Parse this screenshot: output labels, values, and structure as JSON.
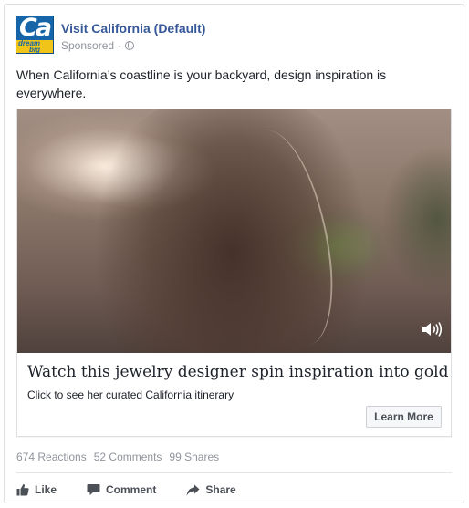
{
  "post": {
    "page_name": "Visit California (Default)",
    "sponsored": "Sponsored",
    "separator": "·",
    "text": "When California’s coastline is your backyard, design inspiration is everywhere.",
    "avatar": {
      "logo_text": "Ca",
      "tagline_1": "dream",
      "tagline_2": "big",
      "brand_color": "#1565a8",
      "accent_color": "#f0c419"
    }
  },
  "attachment": {
    "title": "Watch this jewelry designer spin inspiration into gold",
    "description": "Click to see her curated California itinerary",
    "cta_label": "Learn More",
    "volume_icon": "volume-icon"
  },
  "stats": {
    "reactions": "674 Reactions",
    "comments": "52 Comments",
    "shares": "99 Shares"
  },
  "actions": {
    "like": "Like",
    "comment": "Comment",
    "share": "Share"
  },
  "colors": {
    "link": "#365899",
    "muted": "#90949c",
    "action": "#4b4f56"
  }
}
